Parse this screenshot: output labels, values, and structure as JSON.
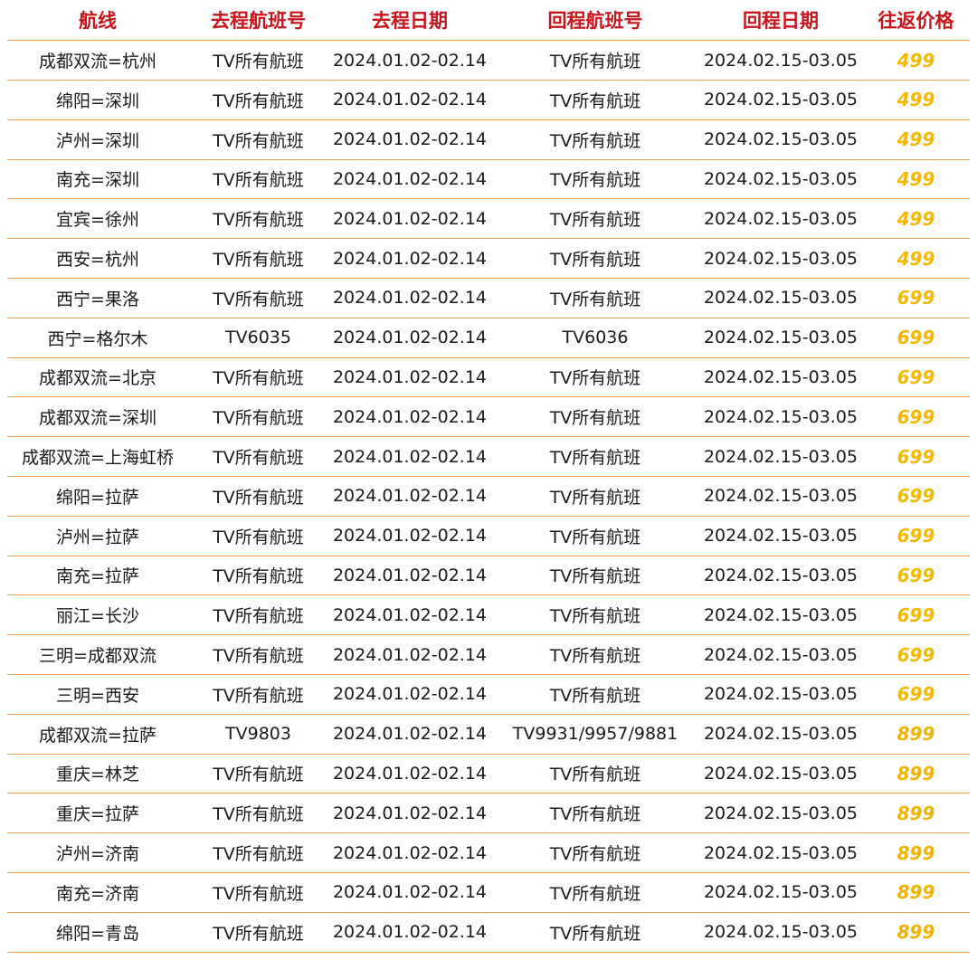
{
  "colors": {
    "header_text": "#c8151b",
    "row_divider": "#f0a050",
    "price_499": "#f5b800",
    "price_699": "#f5b800",
    "price_899": "#f0b400"
  },
  "headers": [
    "航线",
    "去程航班号",
    "去程日期",
    "回程航班号",
    "回程日期",
    "往返价格"
  ],
  "rows": [
    {
      "route": "成都双流=杭州",
      "out_flight": "TV所有航班",
      "out_date": "2024.01.02-02.14",
      "ret_flight": "TV所有航班",
      "ret_date": "2024.02.15-03.05",
      "price": "499"
    },
    {
      "route": "绵阳=深圳",
      "out_flight": "TV所有航班",
      "out_date": "2024.01.02-02.14",
      "ret_flight": "TV所有航班",
      "ret_date": "2024.02.15-03.05",
      "price": "499"
    },
    {
      "route": "泸州=深圳",
      "out_flight": "TV所有航班",
      "out_date": "2024.01.02-02.14",
      "ret_flight": "TV所有航班",
      "ret_date": "2024.02.15-03.05",
      "price": "499"
    },
    {
      "route": "南充=深圳",
      "out_flight": "TV所有航班",
      "out_date": "2024.01.02-02.14",
      "ret_flight": "TV所有航班",
      "ret_date": "2024.02.15-03.05",
      "price": "499"
    },
    {
      "route": "宜宾=徐州",
      "out_flight": "TV所有航班",
      "out_date": "2024.01.02-02.14",
      "ret_flight": "TV所有航班",
      "ret_date": "2024.02.15-03.05",
      "price": "499"
    },
    {
      "route": "西安=杭州",
      "out_flight": "TV所有航班",
      "out_date": "2024.01.02-02.14",
      "ret_flight": "TV所有航班",
      "ret_date": "2024.02.15-03.05",
      "price": "499"
    },
    {
      "route": "西宁=果洛",
      "out_flight": "TV所有航班",
      "out_date": "2024.01.02-02.14",
      "ret_flight": "TV所有航班",
      "ret_date": "2024.02.15-03.05",
      "price": "699"
    },
    {
      "route": "西宁=格尔木",
      "out_flight": "TV6035",
      "out_date": "2024.01.02-02.14",
      "ret_flight": "TV6036",
      "ret_date": "2024.02.15-03.05",
      "price": "699"
    },
    {
      "route": "成都双流=北京",
      "out_flight": "TV所有航班",
      "out_date": "2024.01.02-02.14",
      "ret_flight": "TV所有航班",
      "ret_date": "2024.02.15-03.05",
      "price": "699"
    },
    {
      "route": "成都双流=深圳",
      "out_flight": "TV所有航班",
      "out_date": "2024.01.02-02.14",
      "ret_flight": "TV所有航班",
      "ret_date": "2024.02.15-03.05",
      "price": "699"
    },
    {
      "route": "成都双流=上海虹桥",
      "out_flight": "TV所有航班",
      "out_date": "2024.01.02-02.14",
      "ret_flight": "TV所有航班",
      "ret_date": "2024.02.15-03.05",
      "price": "699"
    },
    {
      "route": "绵阳=拉萨",
      "out_flight": "TV所有航班",
      "out_date": "2024.01.02-02.14",
      "ret_flight": "TV所有航班",
      "ret_date": "2024.02.15-03.05",
      "price": "699"
    },
    {
      "route": "泸州=拉萨",
      "out_flight": "TV所有航班",
      "out_date": "2024.01.02-02.14",
      "ret_flight": "TV所有航班",
      "ret_date": "2024.02.15-03.05",
      "price": "699"
    },
    {
      "route": "南充=拉萨",
      "out_flight": "TV所有航班",
      "out_date": "2024.01.02-02.14",
      "ret_flight": "TV所有航班",
      "ret_date": "2024.02.15-03.05",
      "price": "699"
    },
    {
      "route": "丽江=长沙",
      "out_flight": "TV所有航班",
      "out_date": "2024.01.02-02.14",
      "ret_flight": "TV所有航班",
      "ret_date": "2024.02.15-03.05",
      "price": "699"
    },
    {
      "route": "三明=成都双流",
      "out_flight": "TV所有航班",
      "out_date": "2024.01.02-02.14",
      "ret_flight": "TV所有航班",
      "ret_date": "2024.02.15-03.05",
      "price": "699"
    },
    {
      "route": "三明=西安",
      "out_flight": "TV所有航班",
      "out_date": "2024.01.02-02.14",
      "ret_flight": "TV所有航班",
      "ret_date": "2024.02.15-03.05",
      "price": "699"
    },
    {
      "route": "成都双流=拉萨",
      "out_flight": "TV9803",
      "out_date": "2024.01.02-02.14",
      "ret_flight": "TV9931/9957/9881",
      "ret_date": "2024.02.15-03.05",
      "price": "899"
    },
    {
      "route": "重庆=林芝",
      "out_flight": "TV所有航班",
      "out_date": "2024.01.02-02.14",
      "ret_flight": "TV所有航班",
      "ret_date": "2024.02.15-03.05",
      "price": "899"
    },
    {
      "route": "重庆=拉萨",
      "out_flight": "TV所有航班",
      "out_date": "2024.01.02-02.14",
      "ret_flight": "TV所有航班",
      "ret_date": "2024.02.15-03.05",
      "price": "899"
    },
    {
      "route": "泸州=济南",
      "out_flight": "TV所有航班",
      "out_date": "2024.01.02-02.14",
      "ret_flight": "TV所有航班",
      "ret_date": "2024.02.15-03.05",
      "price": "899"
    },
    {
      "route": "南充=济南",
      "out_flight": "TV所有航班",
      "out_date": "2024.01.02-02.14",
      "ret_flight": "TV所有航班",
      "ret_date": "2024.02.15-03.05",
      "price": "899"
    },
    {
      "route": "绵阳=青岛",
      "out_flight": "TV所有航班",
      "out_date": "2024.01.02-02.14",
      "ret_flight": "TV所有航班",
      "ret_date": "2024.02.15-03.05",
      "price": "899"
    }
  ]
}
